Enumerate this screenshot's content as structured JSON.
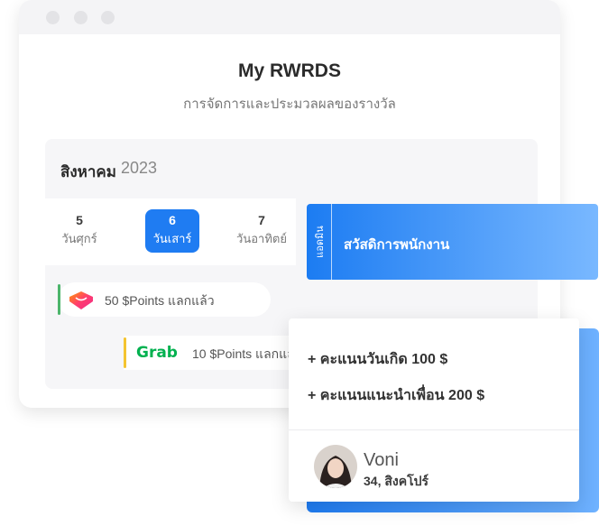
{
  "header": {
    "title": "My RWRDS",
    "subtitle": "การจัดการและประมวลผลของรางวัล"
  },
  "calendar": {
    "month": "สิงหาคม",
    "year": "2023",
    "days": [
      {
        "num": "5",
        "name": "วันศุกร์"
      },
      {
        "num": "6",
        "name": "วันเสาร์",
        "selected": true
      },
      {
        "num": "7",
        "name": "วันอาทิตย์"
      }
    ]
  },
  "transactions": [
    {
      "brand": "Lazada",
      "text": "50 $Points แลกแล้ว",
      "color": "#4cb56b"
    },
    {
      "brand": "Grab",
      "text": "10 $Points แลกแล้ว",
      "color": "#f4c430"
    }
  ],
  "welfare": {
    "vertical": "แอดมิน",
    "title": "สวัสดิการพนักงาน"
  },
  "bonuses": [
    "+ คะแนนวันเกิด 100 $",
    "+ คะแนนแนะนำเพื่อน 200 $"
  ],
  "user": {
    "name": "Voni",
    "location": "34, สิงคโปร์"
  },
  "colors": {
    "primary": "#1f7cf2",
    "grab": "#00b14f"
  }
}
